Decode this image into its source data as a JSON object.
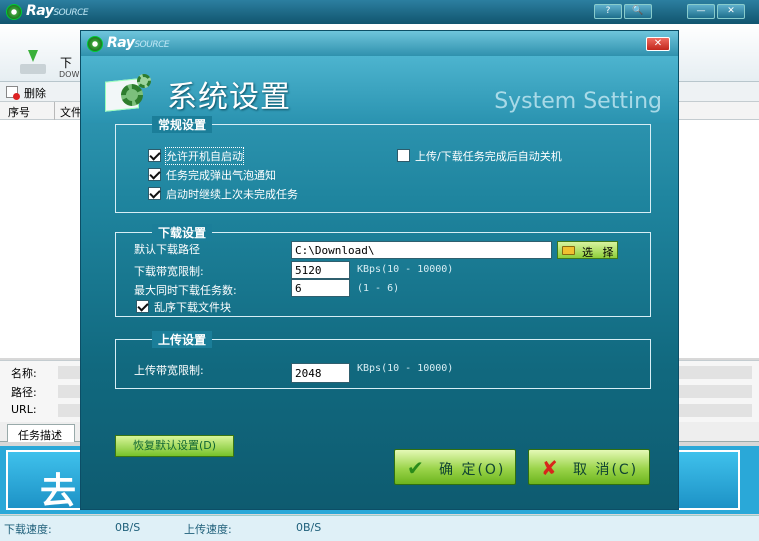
{
  "main": {
    "logo_text": "Ray",
    "logo_sub": "SOURCE",
    "title_buttons": [
      "?",
      "🔍",
      "—",
      "✕"
    ],
    "toolbar": {
      "download_label": "下",
      "download_sub": "DOW"
    },
    "action": {
      "delete_label": "删除"
    },
    "table": {
      "columns": [
        "序号",
        "文件"
      ]
    },
    "info": {
      "name_label": "名称:",
      "path_label": "路径:",
      "url_label": "URL:"
    },
    "tab": {
      "task_desc": "任务描述"
    },
    "banner_text": "去",
    "status": {
      "download_label": "下载速度:",
      "download_value": "0B/S",
      "upload_label": "上传速度:",
      "upload_value": "0B/S"
    }
  },
  "dialog": {
    "logo_text": "Ray",
    "logo_sub": "SOURCE",
    "close_label": "✕",
    "title": "系统设置",
    "title_en": "System Setting",
    "general": {
      "legend": "常规设置",
      "autostart": "允许开机自启动",
      "popup_notify": "任务完成弹出气泡通知",
      "resume_tasks": "启动时继续上次未完成任务",
      "auto_shutdown": "上传/下载任务完成后自动关机"
    },
    "download": {
      "legend": "下载设置",
      "path_label": "默认下载路径",
      "path_value": "C:\\Download\\",
      "select_label": "选 择",
      "bandwidth_label": "下载带宽限制:",
      "bandwidth_value": "5120",
      "bandwidth_unit": "KBps(10 - 10000)",
      "max_tasks_label": "最大同时下载任务数:",
      "max_tasks_value": "6",
      "max_tasks_unit": "(1 - 6)",
      "random_blocks": "乱序下载文件块"
    },
    "upload": {
      "legend": "上传设置",
      "bandwidth_label": "上传带宽限制:",
      "bandwidth_value": "2048",
      "bandwidth_unit": "KBps(10 - 10000)"
    },
    "buttons": {
      "restore": "恢复默认设置(D)",
      "ok": "确 定(O)",
      "cancel": "取 消(C)"
    },
    "checkbox_states": {
      "autostart": true,
      "popup_notify": true,
      "resume_tasks": true,
      "auto_shutdown": false,
      "random_blocks": true
    }
  }
}
